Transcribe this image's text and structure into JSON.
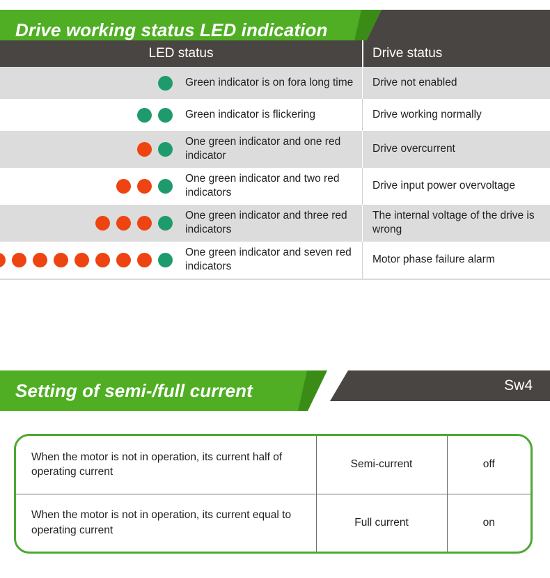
{
  "led_section": {
    "banner_title": "Drive working status LED indication",
    "columns": {
      "led_status": "LED status",
      "drive_status": "Drive status"
    },
    "rows": [
      {
        "dots": [
          "green"
        ],
        "led_status": "Green indicator is on fora long time",
        "drive_status": "Drive not enabled"
      },
      {
        "dots": [
          "green",
          "green"
        ],
        "led_status": "Green indicator is flickering",
        "drive_status": "Drive working normally"
      },
      {
        "dots": [
          "red",
          "green"
        ],
        "led_status": "One green indicator and one red indicator",
        "drive_status": "Drive overcurrent"
      },
      {
        "dots": [
          "red",
          "red",
          "green"
        ],
        "led_status": "One green indicator and two red indicators",
        "drive_status": "Drive input power overvoltage"
      },
      {
        "dots": [
          "red",
          "red",
          "red",
          "green"
        ],
        "led_status": "One green indicator and three red indicators",
        "drive_status": "The internal voltage of the drive is wrong"
      },
      {
        "dots": [
          "red",
          "red",
          "red",
          "red",
          "red",
          "red",
          "red",
          "red",
          "green"
        ],
        "led_status": "One green indicator and seven red indicators",
        "drive_status": "Motor phase failure alarm"
      }
    ]
  },
  "current_section": {
    "banner_title": "Setting of semi-/full current",
    "switch_label": "Sw4",
    "rows": [
      {
        "description": "When the motor is not in operation, its current half of operating current",
        "mode": "Semi-current",
        "state": "off"
      },
      {
        "description": "When the motor is not in operation, its current equal to operating current",
        "mode": "Full current",
        "state": "on"
      }
    ]
  },
  "colors": {
    "green_banner": "#4FAE23",
    "green_banner_shadow": "#3B8C17",
    "dark_bar": "#494542",
    "led_green": "#1E9B6C",
    "led_red": "#EE4411",
    "box_border_green": "#4CA832",
    "row_shade": "#DCDCDC"
  }
}
